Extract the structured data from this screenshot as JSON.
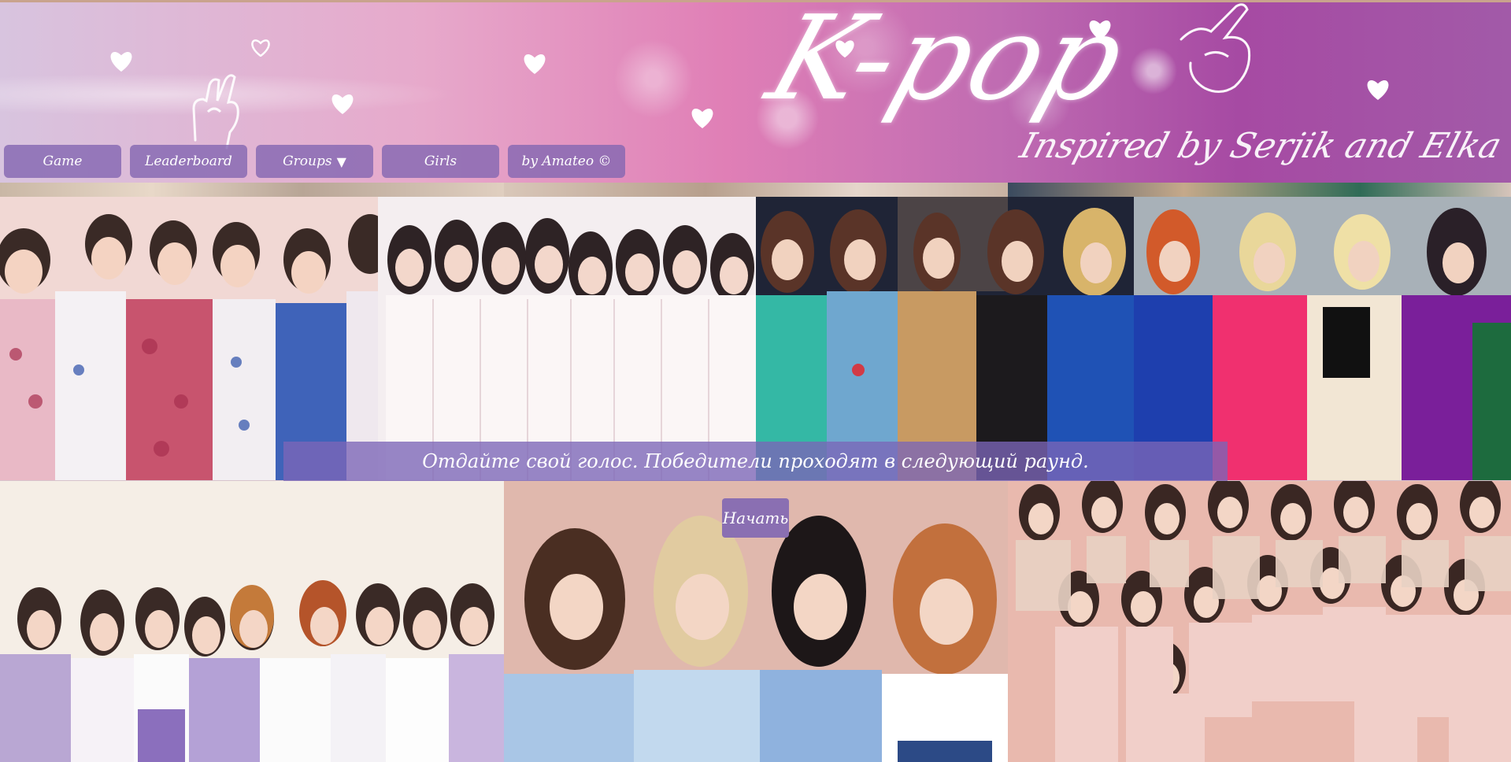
{
  "banner": {
    "logo_text": "K-pop",
    "tagline": "Inspired by Serjik and Elka"
  },
  "nav": {
    "items": [
      {
        "label": "Game"
      },
      {
        "label": "Leaderboard"
      },
      {
        "label": "Groups",
        "dropdown_glyph": "▼"
      },
      {
        "label": "Girls"
      },
      {
        "label": "by Amateo ©"
      }
    ]
  },
  "main": {
    "message": "Отдайте свой голос. Победители проходят в следующий раунд.",
    "start_label": "Начать"
  },
  "colors": {
    "nav_button": "#8568b2",
    "message_bar": "#7b65b7",
    "start_button": "#8a6fb2"
  },
  "photos": [
    {
      "icon": "group-photo-pastel-floral"
    },
    {
      "icon": "group-photo-white-outfits"
    },
    {
      "icon": "group-photo-colorful-dresses"
    },
    {
      "icon": "group-photo-bold-suits"
    },
    {
      "icon": "group-photo-lavender-white"
    },
    {
      "icon": "group-photo-light-blue"
    },
    {
      "icon": "group-photo-pink-beige"
    }
  ]
}
